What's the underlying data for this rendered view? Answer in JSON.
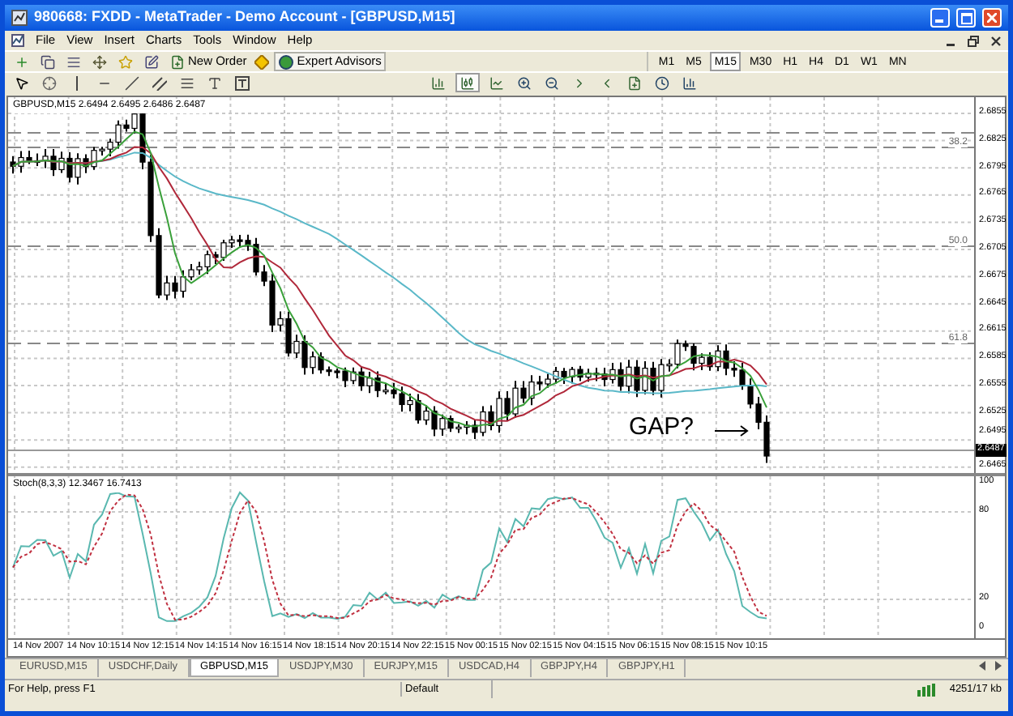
{
  "window": {
    "title": "980668: FXDD - MetaTrader - Demo Account - [GBPUSD,M15]"
  },
  "menu": [
    "File",
    "View",
    "Insert",
    "Charts",
    "Tools",
    "Window",
    "Help"
  ],
  "toolbar": {
    "new_order": "New Order",
    "expert_advisors": "Expert Advisors",
    "timeframes": [
      {
        "label": "M1",
        "selected": false
      },
      {
        "label": "M5",
        "selected": false
      },
      {
        "label": "M15",
        "selected": true
      },
      {
        "label": "M30",
        "selected": false
      },
      {
        "label": "H1",
        "selected": false
      },
      {
        "label": "H4",
        "selected": false
      },
      {
        "label": "D1",
        "selected": false
      },
      {
        "label": "W1",
        "selected": false
      },
      {
        "label": "MN",
        "selected": false
      }
    ]
  },
  "chart": {
    "header": "GBPUSD,M15  2.6494 2.6495 2.6486 2.6487",
    "price_axis": [
      "2.6855",
      "2.6825",
      "2.6795",
      "2.6765",
      "2.6735",
      "2.6705",
      "2.6675",
      "2.6645",
      "2.6615",
      "2.6585",
      "2.6555",
      "2.6525",
      "2.6495",
      "2.6465"
    ],
    "current_price": "2.6487",
    "fib_levels": [
      "38.2",
      "50.0",
      "61.8"
    ],
    "annotation": "GAP?",
    "indicator": {
      "header": "Stoch(8,3,3) 12.3467 16.7413",
      "axis": [
        "100",
        "80",
        "20",
        "0"
      ]
    },
    "time_axis": [
      "14 Nov 2007",
      "14 Nov 10:15",
      "14 Nov 12:15",
      "14 Nov 14:15",
      "14 Nov 16:15",
      "14 Nov 18:15",
      "14 Nov 20:15",
      "14 Nov 22:15",
      "15 Nov 00:15",
      "15 Nov 02:15",
      "15 Nov 04:15",
      "15 Nov 06:15",
      "15 Nov 08:15",
      "15 Nov 10:15"
    ]
  },
  "tabs": [
    {
      "label": "EURUSD,M15",
      "selected": false
    },
    {
      "label": "USDCHF,Daily",
      "selected": false
    },
    {
      "label": "GBPUSD,M15",
      "selected": true
    },
    {
      "label": "USDJPY,M30",
      "selected": false
    },
    {
      "label": "EURJPY,M15",
      "selected": false
    },
    {
      "label": "USDCAD,H4",
      "selected": false
    },
    {
      "label": "GBPJPY,H4",
      "selected": false
    },
    {
      "label": "GBPJPY,H1",
      "selected": false
    }
  ],
  "status_bar": {
    "help": "For Help, press F1",
    "profile": "Default",
    "traffic": "4251/17 kb"
  }
}
